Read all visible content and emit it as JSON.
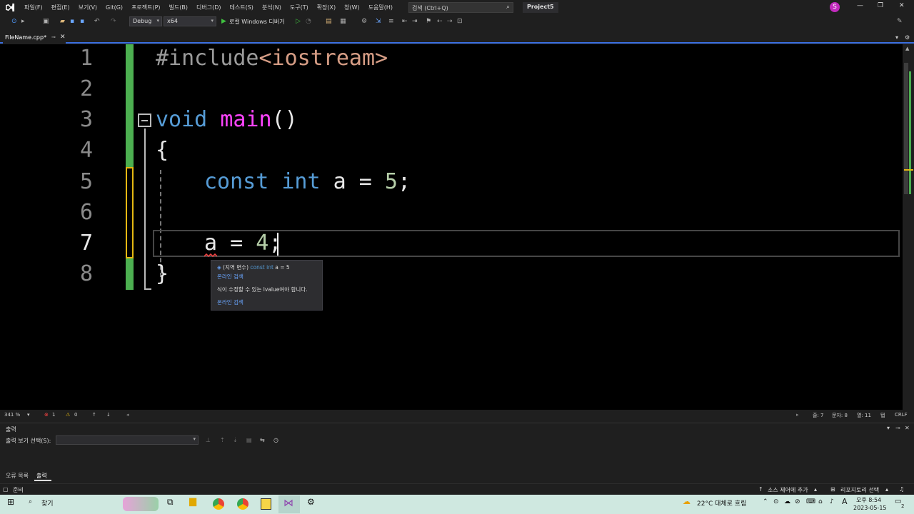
{
  "menu": [
    "파일(F)",
    "편집(E)",
    "보기(V)",
    "Git(G)",
    "프로젝트(P)",
    "빌드(B)",
    "디버그(D)",
    "테스트(S)",
    "분석(N)",
    "도구(T)",
    "확장(X)",
    "창(W)",
    "도움말(H)"
  ],
  "search": {
    "placeholder": "검색 (Ctrl+Q)"
  },
  "project_name": "Project5",
  "avatar_letter": "S",
  "toolbar": {
    "config": "Debug",
    "platform": "x64",
    "run_label": "로컬 Windows 디버거"
  },
  "tab": {
    "filename": "FileName.cpp*"
  },
  "editor": {
    "line_numbers": [
      "1",
      "2",
      "3",
      "4",
      "5",
      "6",
      "7",
      "8"
    ],
    "current_line": "7",
    "code": {
      "l1_pre": "#include",
      "l1_str": "<iostream>",
      "l3_kw": "void",
      "l3_fn": "main",
      "l3_rest": "()",
      "l4": "{",
      "l5_kw1": "const",
      "l5_kw2": "int",
      "l5_rest": " a = ",
      "l5_num": "5",
      "l5_end": ";",
      "l7_var": "a",
      "l7_mid": " = ",
      "l7_num": "4",
      "l7_end": ";",
      "l8": "}"
    }
  },
  "tooltip": {
    "scope": "(지역 변수)",
    "decl": "const int",
    "decl_rest": "a = 5",
    "online1": "온라인 검색",
    "message": "식이 수정할 수 있는 lvalue여야 합니다.",
    "online2": "온라인 검색"
  },
  "editor_status": {
    "zoom": "341 %",
    "errors": "1",
    "warnings": "0",
    "line": "줄: 7",
    "char": "문자: 8",
    "col": "열: 11",
    "tab": "탭",
    "eol": "CRLF"
  },
  "output": {
    "title": "출력",
    "source_label": "출력 보기 선택(S):"
  },
  "bottom_tabs": [
    "오류 목록",
    "출력"
  ],
  "statusbar": {
    "ready": "준비",
    "source_control": "소스 제어에 추가",
    "repo": "리포지토리 선택"
  },
  "taskbar": {
    "search": "찾기",
    "weather": "22°C 대체로 흐림",
    "time": "오후 8:54",
    "date": "2023-05-15",
    "lang": "A",
    "notif": "2"
  },
  "colors": {
    "green_change": "#4caf50",
    "yellow_change": "#e5b812",
    "accent": "#3a6ee0"
  }
}
